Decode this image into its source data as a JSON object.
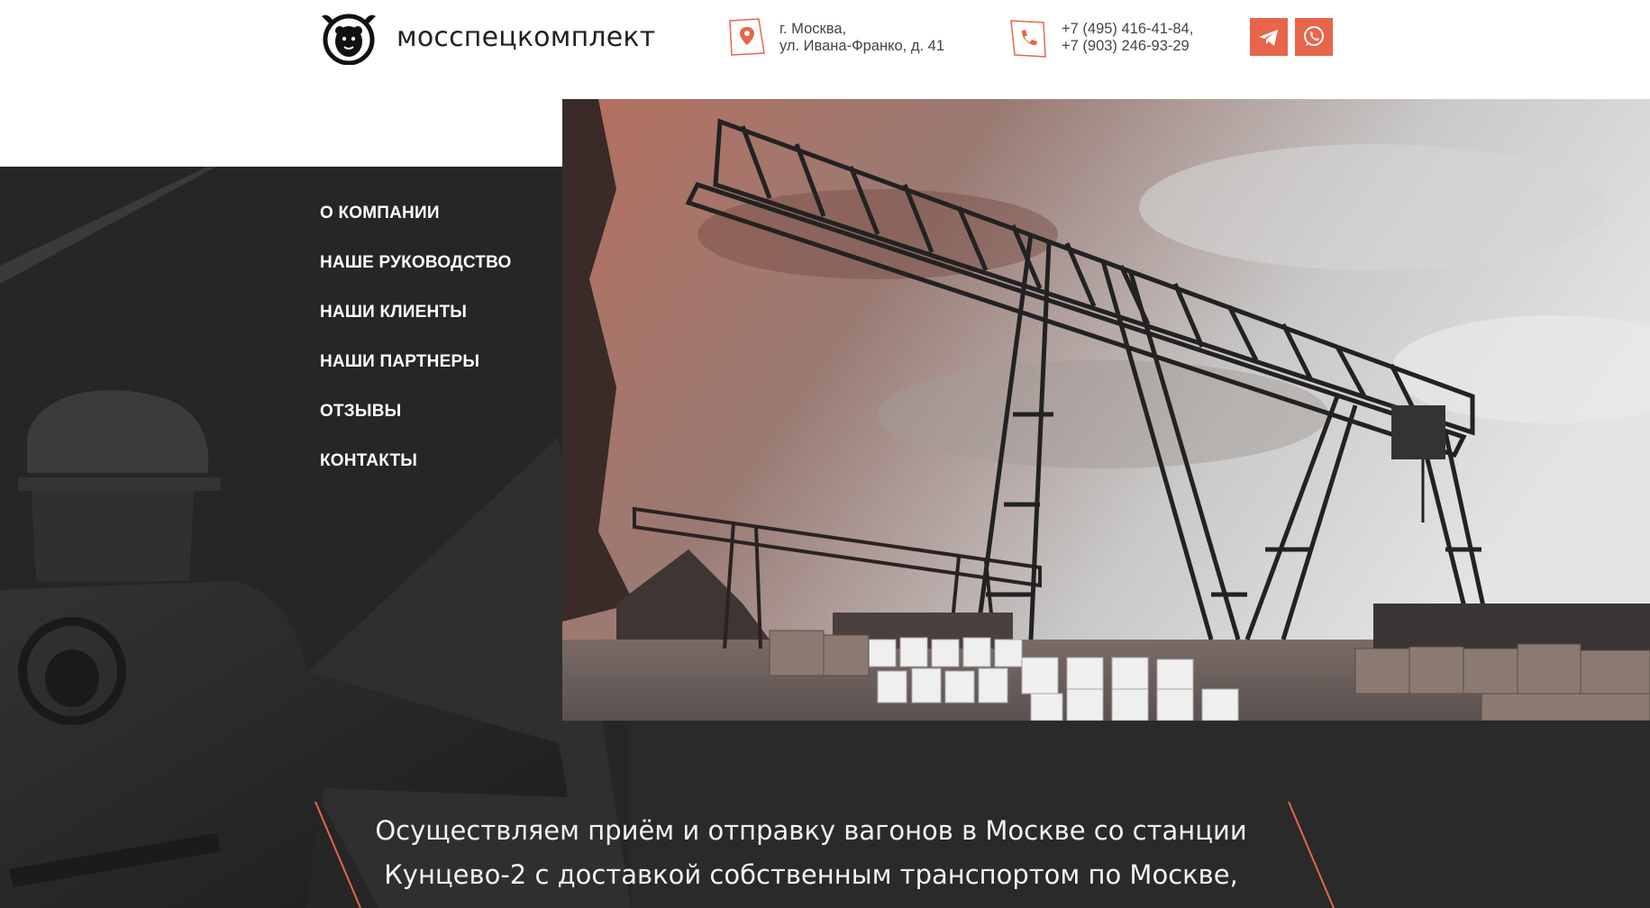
{
  "header": {
    "logo_text": "мосспецкомплект",
    "logo_icon": "bear-horseshoe-logo",
    "address_line1": "г. Москва,",
    "address_line2": "ул. Ивана-Франко, д. 41",
    "phone1": "+7 (495) 416-41-84,",
    "phone2": "+7 (903) 246-93-29",
    "location_icon": "map-pin-icon",
    "phone_icon": "phone-icon",
    "telegram_icon": "telegram-icon",
    "whatsapp_icon": "whatsapp-icon",
    "accent_color": "#e8654a"
  },
  "nav": {
    "items": [
      {
        "label": "О КОМПАНИИ"
      },
      {
        "label": "НАШЕ РУКОВОДСТВО"
      },
      {
        "label": "НАШИ КЛИЕНТЫ"
      },
      {
        "label": "НАШИ ПАРТНЕРЫ"
      },
      {
        "label": "ОТЗЫВЫ"
      },
      {
        "label": "КОНТАКТЫ"
      }
    ]
  },
  "mission": {
    "line1": "Осуществляем приём и отправку вагонов в Москве со станции",
    "line2": "Кунцево-2 с доставкой собственным транспортом по Москве,"
  },
  "colors": {
    "dark_bg": "#2a2a2a",
    "accent": "#e8654a"
  }
}
